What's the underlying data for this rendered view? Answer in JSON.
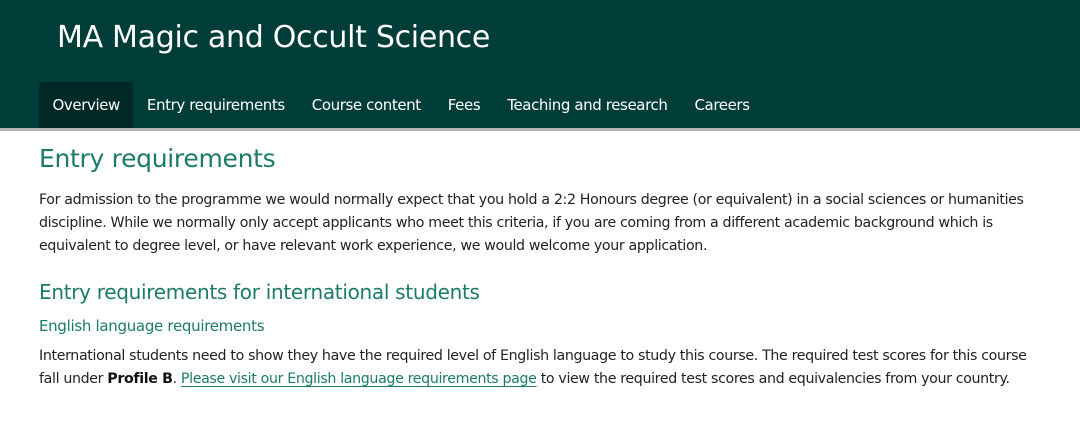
{
  "header": {
    "title": "MA Magic and Occult Science"
  },
  "nav": {
    "items": [
      {
        "label": "Overview"
      },
      {
        "label": "Entry requirements"
      },
      {
        "label": "Course content"
      },
      {
        "label": "Fees"
      },
      {
        "label": "Teaching and research"
      },
      {
        "label": "Careers"
      }
    ],
    "active": "Overview"
  },
  "main": {
    "heading": "Entry requirements",
    "intro": "For admission to the programme we would normally expect that you hold a 2:2 Honours degree (or equivalent) in a social sciences or humanities discipline. While we normally only accept applicants who meet this criteria, if you are coming from a different academic background which is equivalent to degree level, or have relevant work experience, we would welcome your application.",
    "intl_heading": "Entry requirements for international students",
    "english_heading": "English language requirements",
    "english_text_before": "International students need to show they have the required level of English language to study this course. The required test scores for this course fall under ",
    "profile": "Profile B",
    "period": ". ",
    "link_text": "Please visit our English language requirements page",
    "english_text_after": " to view the required test scores and equivalencies from your country."
  },
  "colors": {
    "header_bg": "#003d39",
    "active_tab_bg": "#012a27",
    "accent": "#1d7a69"
  }
}
